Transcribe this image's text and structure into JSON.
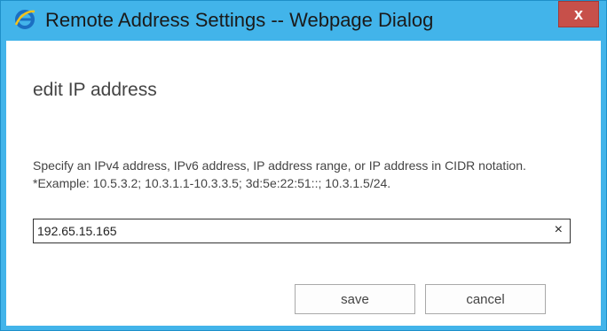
{
  "window": {
    "title": "Remote Address Settings -- Webpage Dialog",
    "close_label": "x",
    "app_icon": "internet-explorer-icon"
  },
  "dialog": {
    "heading": "edit IP address",
    "description": "Specify an IPv4 address, IPv6 address, IP address range, or IP address in CIDR notation.",
    "example": "*Example: 10.5.3.2; 10.3.1.1-10.3.3.5; 3d:5e:22:51::; 10.3.1.5/24.",
    "ip_value": "192.65.15.165",
    "clear_label": "×",
    "save_label": "save",
    "cancel_label": "cancel"
  },
  "colors": {
    "frame": "#42b4ea",
    "close_button": "#c7504a"
  }
}
